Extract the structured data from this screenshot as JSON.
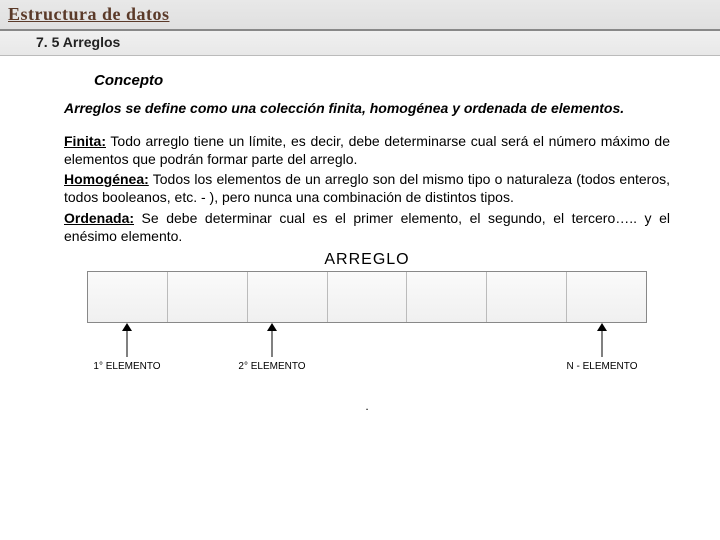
{
  "header": {
    "title": "Estructura de datos",
    "section": "7. 5 Arreglos"
  },
  "concept": {
    "heading": "Concepto",
    "definition": "Arreglos se define como una colección finita, homogénea y ordenada de elementos."
  },
  "terms": {
    "finita_label": "Finita:",
    "finita_text": " Todo arreglo tiene un límite, es decir, debe determinarse cual será el número máximo de elementos que podrán formar parte del arreglo.",
    "homogenea_label": "Homogénea:",
    "homogenea_text": " Todos los elementos de un arreglo son del mismo tipo o naturaleza (todos enteros, todos booleanos, etc. - ), pero nunca una combinación de distintos tipos.",
    "ordenada_label": "Ordenada:",
    "ordenada_text": " Se debe determinar cual es el primer elemento, el segundo, el tercero….. y el enésimo elemento."
  },
  "diagram": {
    "title": "ARREGLO",
    "labels": {
      "first": "1° ELEMENTO",
      "second": "2° ELEMENTO",
      "nth": "N - ELEMENTO"
    }
  },
  "footer_dot": "."
}
